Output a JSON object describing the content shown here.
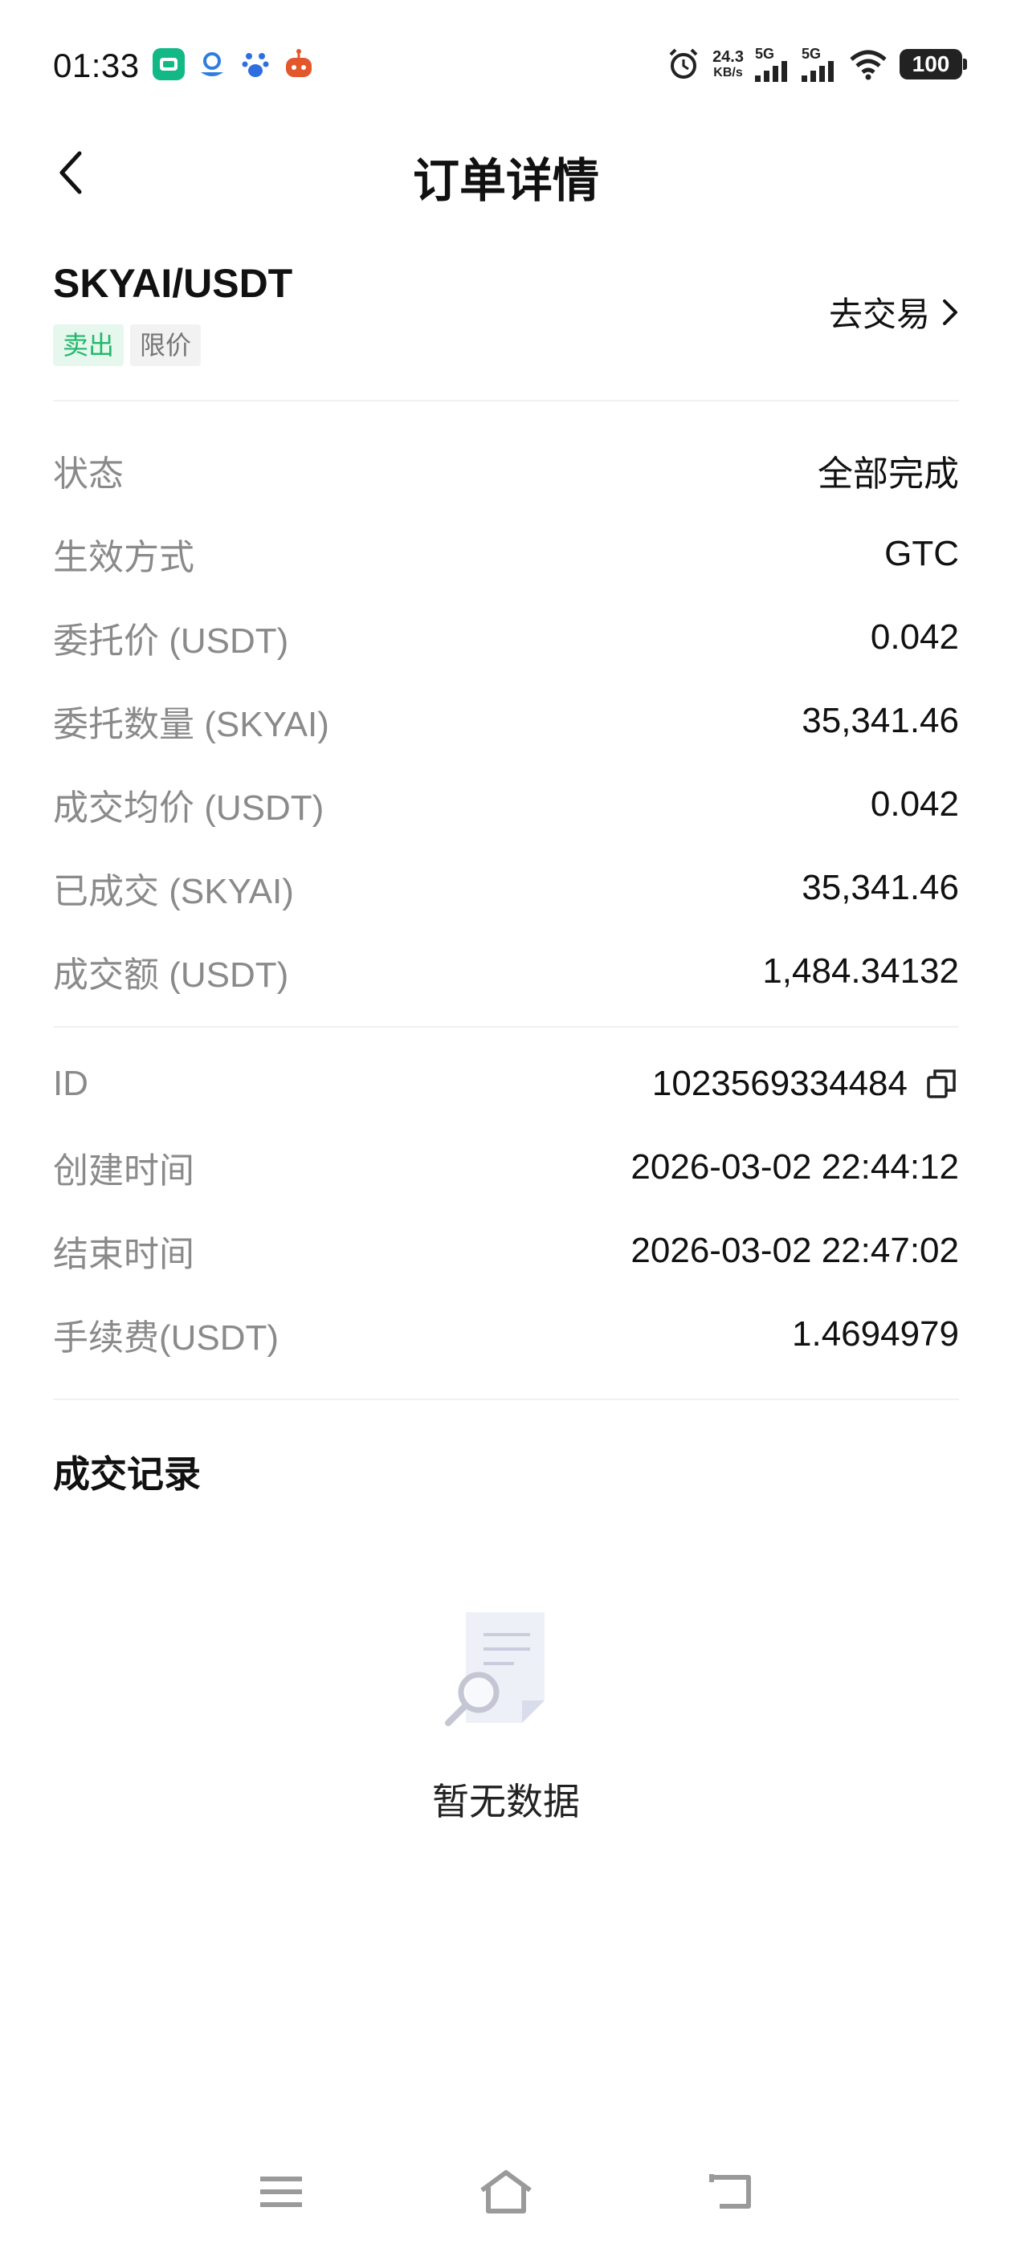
{
  "status_bar": {
    "time": "01:33",
    "net_speed_value": "24.3",
    "net_speed_unit": "KB/s",
    "signal1_label": "5G",
    "signal2_label": "5G",
    "battery": "100"
  },
  "header": {
    "title": "订单详情"
  },
  "order": {
    "pair": "SKYAI/USDT",
    "side_tag": "卖出",
    "type_tag": "限价",
    "trade_link": "去交易"
  },
  "details": [
    {
      "label": "状态",
      "value": "全部完成"
    },
    {
      "label": "生效方式",
      "value": "GTC"
    },
    {
      "label": "委托价 (USDT)",
      "value": "0.042"
    },
    {
      "label": "委托数量 (SKYAI)",
      "value": "35,341.46"
    },
    {
      "label": "成交均价 (USDT)",
      "value": "0.042"
    },
    {
      "label": "已成交 (SKYAI)",
      "value": "35,341.46"
    },
    {
      "label": "成交额 (USDT)",
      "value": "1,484.34132"
    }
  ],
  "meta": [
    {
      "label": "ID",
      "value": "1023569334484"
    },
    {
      "label": "创建时间",
      "value": "2026-03-02 22:44:12"
    },
    {
      "label": "结束时间",
      "value": "2026-03-02 22:47:02"
    },
    {
      "label": "手续费(USDT)",
      "value": "1.4694979"
    }
  ],
  "trades": {
    "title": "成交记录",
    "empty_text": "暂无数据"
  },
  "colors": {
    "sell_green": "#22b86a",
    "label_gray": "#8a8a8a"
  }
}
